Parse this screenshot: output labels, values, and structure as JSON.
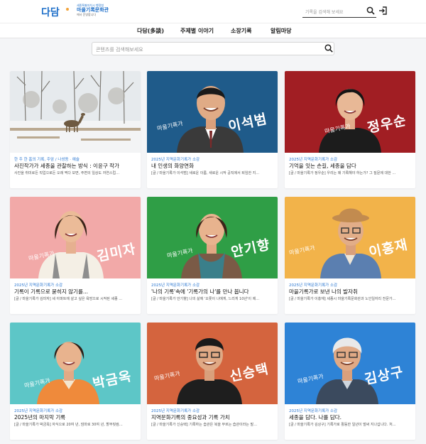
{
  "header": {
    "logo": "다담",
    "partner": {
      "line1": "세종특별자치시 행정청",
      "line2": "마을기록문화관",
      "line3": "에서 운영합니다"
    },
    "search_placeholder": "기록을 검색해 보세요",
    "icons": [
      "search-icon",
      "login-icon"
    ]
  },
  "nav": {
    "items": [
      "다담(多談)",
      "주제별 이야기",
      "소장기록",
      "알림마당"
    ]
  },
  "search": {
    "placeholder": "콘텐츠를 검색해보세요"
  },
  "banner_label": "마을기록가",
  "colors": {
    "accent": "#2d78d1",
    "brand": "#1e6fc9"
  },
  "cards": [
    {
      "category": "한 주 한 홈의 기록, 주암 / 나성동 · 예술",
      "title": "사진작가가 세종을 관찰하는 방식 : 이윤구 작가",
      "desc": "사진을 취미로든 직업으로든 오래 찍다 보면, 주변의 일상도 자연스럽…",
      "bg": "#dfe4e8"
    },
    {
      "category": "2025년 지역문화기록가 소감",
      "title": "내 인생의 화양연화",
      "desc": "[글 / 마을기록가 이석범]  새로운 이름, 새로운 시작 공직에서 퇴임한 지…",
      "name": "이석범",
      "bg": "#1f5b8a"
    },
    {
      "category": "2025년 지역문화기록가 소감",
      "title": "기억을 잇는 손길, 세종을 담다",
      "desc": "[글 / 마을기록가 정우순]  우리는 왜 기록해야 하는가? 그 질문에 대한 …",
      "name": "정우순",
      "bg": "#a11e23"
    },
    {
      "category": "2025년 지역문화기록가 소감",
      "title": "기록이 기록으로 묻히지 않기를...",
      "desc": "[글 / 마을기록가 김미자]  세 아파트에 살고 싶은 욕망으로 시작된 세종 …",
      "name": "김미자",
      "bg": "#f2a9a8"
    },
    {
      "category": "2025년 지역문화기록가 소감",
      "title": "'나의 기록'속에 '기록가의 나'를 만나 봅니다",
      "desc": "[글 / 마을기록가 안기향]  나의 삶에 '오롯이 나에게, 느리게 10년'이 제…",
      "name": "안기향",
      "bg": "#2f9e46"
    },
    {
      "category": "2025년 지역문화기록가 소감",
      "title": "마을기록가로 보낸 나의 발자취",
      "desc": "[글 / 마을기록가 이홍재]  세종시 마을기록문화관과 노인일자리 전문가…",
      "name": "이홍재",
      "bg": "#f2b34a"
    },
    {
      "category": "2025년 지역문화기록가 소감",
      "title": "2025년의 마지막 기록",
      "desc": "[글 / 마을기록가 박금옥]  자식으로 20여 년, 엄마로 30여 년, 할부핏컴…",
      "name": "박금옥",
      "bg": "#5dc6c7"
    },
    {
      "category": "2025년 지역문화기록가 소감",
      "title": "지역문화기록의 중요성과 기록 가치",
      "desc": "[글 / 마을기록가 신승택]  기록하는 습관은 복을 부르는 습관이라는 말…",
      "name": "신승택",
      "bg": "#d4643e"
    },
    {
      "category": "2025년 지역문화기록가 소감",
      "title": "세종을 담다. 나를 담다.",
      "desc": "[글 / 마을기록가 김상구]  기록가로 활동한 일년이 벌써 지나갑니다. 처…",
      "name": "김상구",
      "bg": "#2e83d6"
    }
  ]
}
